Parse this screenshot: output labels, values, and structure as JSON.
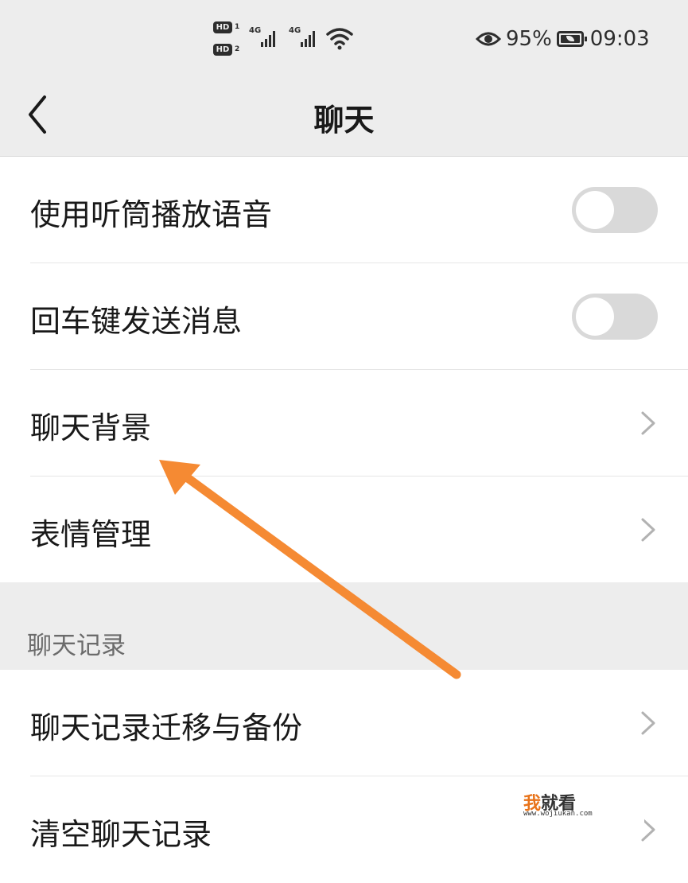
{
  "status_bar": {
    "hd1": "HD",
    "hd1_sim": "1",
    "hd2": "HD",
    "hd2_sim": "2",
    "network1": "4G",
    "network2": "4G",
    "eye_icon": "eye-icon",
    "battery_percent": "95%",
    "time": "09:03"
  },
  "nav": {
    "title": "聊天",
    "back_icon": "chevron-left-icon"
  },
  "settings": {
    "earpiece_label": "使用听筒播放语音",
    "earpiece_on": false,
    "enter_send_label": "回车键发送消息",
    "enter_send_on": false,
    "background_label": "聊天背景",
    "stickers_label": "表情管理"
  },
  "history": {
    "section_title": "聊天记录",
    "migrate_label": "聊天记录迁移与备份",
    "clear_label": "清空聊天记录"
  },
  "watermark": {
    "brand_first": "我",
    "brand_rest": "就看",
    "url": "www.wojiukan.com"
  },
  "colors": {
    "page_bg": "#ededed",
    "card_bg": "#ffffff",
    "toggle_off": "#d9d9d9",
    "annotation_arrow": "#f58a33",
    "watermark_accent": "#e8731a"
  }
}
